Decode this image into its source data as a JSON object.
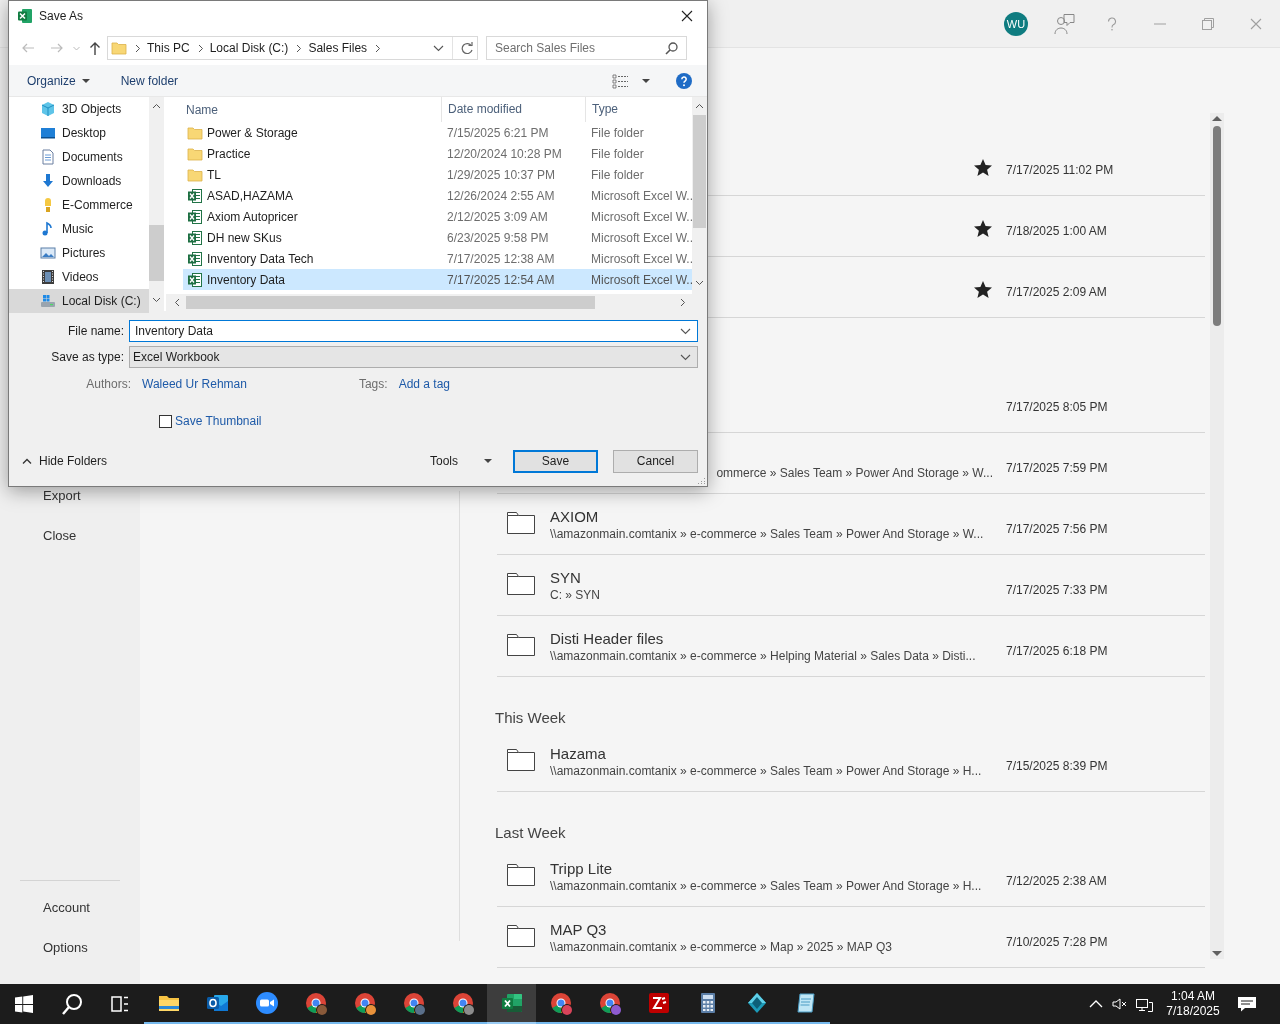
{
  "excel_titlebar": {
    "avatar": "WU"
  },
  "backstage_nav": {
    "items": [
      {
        "label": "Export"
      },
      {
        "label": "Close"
      }
    ],
    "footer_items": [
      {
        "label": "Account"
      },
      {
        "label": "Options"
      }
    ]
  },
  "recent": {
    "sections": [
      {
        "items": [
          {
            "kind": "covered",
            "pinned": true,
            "date": "7/17/2025 11:02 PM"
          },
          {
            "kind": "covered",
            "pinned": true,
            "date": "7/18/2025 1:00 AM"
          },
          {
            "kind": "covered",
            "pinned": true,
            "date": "7/17/2025 2:09 AM"
          }
        ]
      },
      {
        "items": [
          {
            "kind": "covered",
            "pinned": false,
            "date": "7/17/2025 8:05 PM"
          },
          {
            "kind": "clipped",
            "pinned": false,
            "path": "ommerce » Sales Team » Power And Storage » W...",
            "date": "7/17/2025 7:59 PM"
          },
          {
            "kind": "folder",
            "pinned": false,
            "name": "AXIOM",
            "path": "\\\\amazonmain.comtanix » e-commerce » Sales Team » Power And Storage » W...",
            "date": "7/17/2025 7:56 PM"
          },
          {
            "kind": "folder",
            "pinned": false,
            "name": "SYN",
            "path": "C: » SYN",
            "date": "7/17/2025 7:33 PM"
          },
          {
            "kind": "folder",
            "pinned": false,
            "name": "Disti Header files",
            "path": "\\\\amazonmain.comtanix » e-commerce » Helping Material » Sales Data » Disti...",
            "date": "7/17/2025 6:18 PM"
          }
        ]
      },
      {
        "title": "This Week",
        "items": [
          {
            "kind": "folder",
            "pinned": false,
            "name": "Hazama",
            "path": "\\\\amazonmain.comtanix » e-commerce » Sales Team » Power And Storage » H...",
            "date": "7/15/2025 8:39 PM"
          }
        ]
      },
      {
        "title": "Last Week",
        "items": [
          {
            "kind": "folder",
            "pinned": false,
            "name": "Tripp Lite",
            "path": "\\\\amazonmain.comtanix » e-commerce » Sales Team » Power And Storage » H...",
            "date": "7/12/2025 2:38 AM"
          },
          {
            "kind": "folder",
            "pinned": false,
            "name": "MAP Q3",
            "path": "\\\\amazonmain.comtanix » e-commerce » Map » 2025 » MAP Q3",
            "date": "7/10/2025 7:28 PM"
          }
        ]
      }
    ]
  },
  "save_dialog": {
    "title": "Save As",
    "address": [
      "This PC",
      "Local Disk (C:)",
      "Sales Files"
    ],
    "search": {
      "placeholder": "Search Sales Files"
    },
    "toolbar": {
      "organize": "Organize",
      "new_folder": "New folder"
    },
    "nav_items": [
      {
        "kind": "cube",
        "label": "3D Objects",
        "selected": false
      },
      {
        "kind": "desktop",
        "label": "Desktop",
        "selected": false
      },
      {
        "kind": "documents",
        "label": "Documents",
        "selected": false
      },
      {
        "kind": "downloads",
        "label": "Downloads",
        "selected": false
      },
      {
        "kind": "bulb",
        "label": "E-Commerce",
        "selected": false
      },
      {
        "kind": "music",
        "label": "Music",
        "selected": false
      },
      {
        "kind": "pictures",
        "label": "Pictures",
        "selected": false
      },
      {
        "kind": "videos",
        "label": "Videos",
        "selected": false
      },
      {
        "kind": "drive",
        "label": "Local Disk (C:)",
        "selected": true
      }
    ],
    "columns": [
      "Name",
      "Date modified",
      "Type"
    ],
    "files": [
      {
        "kind": "folder",
        "name": "Power & Storage",
        "date": "7/15/2025 6:21 PM",
        "type": "File folder",
        "selected": false
      },
      {
        "kind": "folder",
        "name": "Practice",
        "date": "12/20/2024 10:28 PM",
        "type": "File folder",
        "selected": false
      },
      {
        "kind": "folder",
        "name": "TL",
        "date": "1/29/2025 10:37 PM",
        "type": "File folder",
        "selected": false
      },
      {
        "kind": "workbook",
        "name": "ASAD,HAZAMA",
        "date": "12/26/2024 2:55 AM",
        "type": "Microsoft Excel W..",
        "selected": false
      },
      {
        "kind": "workbook",
        "name": "Axiom Autopricer",
        "date": "2/12/2025 3:09 AM",
        "type": "Microsoft Excel W..",
        "selected": false
      },
      {
        "kind": "workbook",
        "name": "DH new SKus",
        "date": "6/23/2025 9:58 PM",
        "type": "Microsoft Excel W..",
        "selected": false
      },
      {
        "kind": "workbook",
        "name": "Inventory Data Tech",
        "date": "7/17/2025 12:38 AM",
        "type": "Microsoft Excel W..",
        "selected": false
      },
      {
        "kind": "workbook",
        "name": "Inventory Data",
        "date": "7/17/2025 12:54 AM",
        "type": "Microsoft Excel W..",
        "selected": true
      }
    ],
    "file_name": {
      "label": "File name:",
      "value": "Inventory Data"
    },
    "save_type": {
      "label": "Save as type:",
      "value": "Excel Workbook"
    },
    "authors": {
      "label": "Authors:",
      "value": "Waleed Ur Rehman"
    },
    "tags": {
      "label": "Tags:",
      "value": "Add a tag"
    },
    "thumbnail": {
      "label": "Save Thumbnail",
      "checked": false
    },
    "hide_folders": "Hide Folders",
    "tools": "Tools",
    "buttons": [
      {
        "label": "Save",
        "default": true
      },
      {
        "label": "Cancel",
        "default": false
      }
    ]
  },
  "taskbar": {
    "apps": [
      {
        "kind": "explorer",
        "running": true,
        "selected": false
      },
      {
        "kind": "mail",
        "running": true,
        "selected": false
      },
      {
        "kind": "video",
        "running": true,
        "selected": false
      },
      {
        "kind": "browser",
        "color": "#8a5a3a",
        "running": true,
        "selected": false
      },
      {
        "kind": "browser",
        "color": "#e8913a",
        "running": true,
        "selected": false
      },
      {
        "kind": "browser",
        "color": "#5a6f8a",
        "running": true,
        "selected": false
      },
      {
        "kind": "browser",
        "color": "#8c8c8c",
        "running": true,
        "selected": false
      },
      {
        "kind": "sheet",
        "running": true,
        "selected": true
      },
      {
        "kind": "browser",
        "color": "#d9445a",
        "running": true,
        "selected": false
      },
      {
        "kind": "browser",
        "color": "#8e5bd0",
        "running": true,
        "selected": false
      },
      {
        "kind": "transfer",
        "running": true,
        "selected": false
      },
      {
        "kind": "calculator",
        "running": true,
        "selected": false
      },
      {
        "kind": "diamond",
        "running": true,
        "selected": false
      },
      {
        "kind": "note",
        "running": true,
        "selected": false
      }
    ],
    "clock": {
      "time": "1:04 AM",
      "date": "7/18/2025"
    }
  }
}
